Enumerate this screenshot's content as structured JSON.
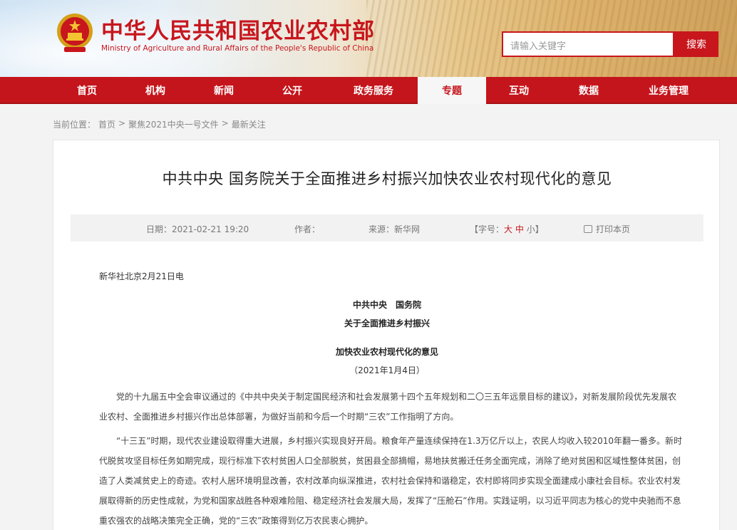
{
  "header": {
    "site_title": "中华人民共和国农业农村部",
    "site_subtitle": "Ministry of Agriculture and Rural Affairs of the People's Republic of China",
    "search_placeholder": "请输入关键字",
    "search_button": "搜索"
  },
  "nav": {
    "items": [
      {
        "label": "首页"
      },
      {
        "label": "机构"
      },
      {
        "label": "新闻"
      },
      {
        "label": "公开"
      },
      {
        "label": "政务服务"
      },
      {
        "label": "专题"
      },
      {
        "label": "互动"
      },
      {
        "label": "数据"
      },
      {
        "label": "业务管理"
      }
    ],
    "active_index": 5
  },
  "breadcrumb": {
    "prefix": "当前位置：",
    "items": [
      "首页",
      "聚焦2021中央一号文件",
      "最新关注"
    ],
    "separator": ">"
  },
  "article": {
    "title": "中共中央 国务院关于全面推进乡村振兴加快农业农村现代化的意见",
    "meta": {
      "date_label": "日期：",
      "date_value": "2021-02-21 19:20",
      "author_label": "作者：",
      "source_label": "来源：",
      "source_value": "新华网",
      "font_label_open": "【字号：",
      "font_large": "大",
      "font_medium": "中",
      "font_small": "小",
      "font_label_close": "】",
      "print_label": "打印本页"
    },
    "dateline": "新华社北京2月21日电",
    "heading_line1": "中共中央　国务院",
    "heading_line2": "关于全面推进乡村振兴",
    "heading_line3": "加快农业农村现代化的意见",
    "heading_date": "（2021年1月4日）",
    "paragraphs": [
      "党的十九届五中全会审议通过的《中共中央关于制定国民经济和社会发展第十四个五年规划和二〇三五年远景目标的建议》，对新发展阶段优先发展农业农村、全面推进乡村振兴作出总体部署，为做好当前和今后一个时期“三农”工作指明了方向。",
      "“十三五”时期，现代农业建设取得重大进展，乡村振兴实现良好开局。粮食年产量连续保持在1.3万亿斤以上，农民人均收入较2010年翻一番多。新时代脱贫攻坚目标任务如期完成，现行标准下农村贫困人口全部脱贫，贫困县全部摘帽，易地扶贫搬迁任务全面完成，消除了绝对贫困和区域性整体贫困，创造了人类减贫史上的奇迹。农村人居环境明显改善，农村改革向纵深推进，农村社会保持和谐稳定，农村即将同步实现全面建成小康社会目标。农业农村发展取得新的历史性成就，为党和国家战胜各种艰难险阻、稳定经济社会发展大局，发挥了“压舱石”作用。实践证明，以习近平同志为核心的党中央驰而不息重农强农的战略决策完全正确，党的“三农”政策得到亿万农民衷心拥护。"
    ]
  },
  "colors": {
    "brand_red": "#c8161d",
    "nav_red": "#c4151c"
  }
}
